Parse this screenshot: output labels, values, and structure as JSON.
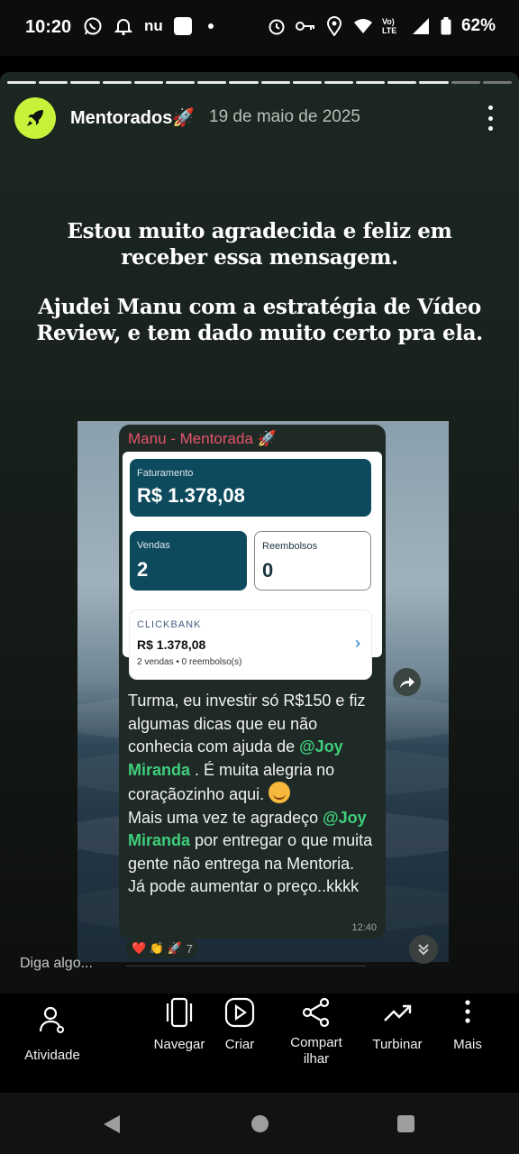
{
  "status_bar": {
    "time": "10:20",
    "carrier_label": "nu",
    "network_label": "Vo) LTE",
    "battery": "62%"
  },
  "story": {
    "progress_segments_total": 16,
    "progress_segments_viewed": 14,
    "account_name": "Mentorados🚀",
    "date": "19 de maio de 2025",
    "caption": {
      "paragraph1": "Estou muito agradecida e feliz em receber essa mensagem.",
      "paragraph2": "Ajudei Manu com a estratégia de Vídeo Review, e tem dado muito certo pra ela."
    },
    "chat": {
      "title": "Manu - Mentorada 🚀",
      "dashboard": {
        "faturamento_label": "Faturamento",
        "faturamento_value": "R$ 1.378,08",
        "vendas_label": "Vendas",
        "vendas_value": "2",
        "reembolsos_label": "Reembolsos",
        "reembolsos_value": "0",
        "clickbank_logo": "CLICKBANK",
        "clickbank_value": "R$ 1.378,08",
        "clickbank_sub": "2 vendas • 0 reembolso(s)"
      },
      "message": {
        "part1": "Turma, eu investir só R$150 e fiz algumas dicas que eu não conhecia com ajuda de ",
        "mention1": "@Joy Miranda",
        "part2": " . É muita alegria no coraçãozinho aqui. ",
        "part3": "Mais uma vez te agradeço ",
        "mention2": "@Joy Miranda",
        "part4": " por entregar o que muita gente não entrega na Mentoria.",
        "part5": "Já pode aumentar o preço..kkkk",
        "time": "12:40"
      },
      "reactions": {
        "emojis": "❤️ 👏 🚀",
        "count": "7"
      }
    },
    "reply_placeholder": "Diga algo..."
  },
  "actions": {
    "atividade": "Atividade",
    "navegar": "Navegar",
    "criar": "Criar",
    "compartilhar_line1": "Compart",
    "compartilhar_line2": "ilhar",
    "turbinar": "Turbinar",
    "mais": "Mais"
  },
  "colors": {
    "avatar_bg": "#c6f33a",
    "dashboard_teal": "#0d4a5e",
    "mention_green": "#3fcf7c",
    "chat_title_red": "#e5546a"
  }
}
